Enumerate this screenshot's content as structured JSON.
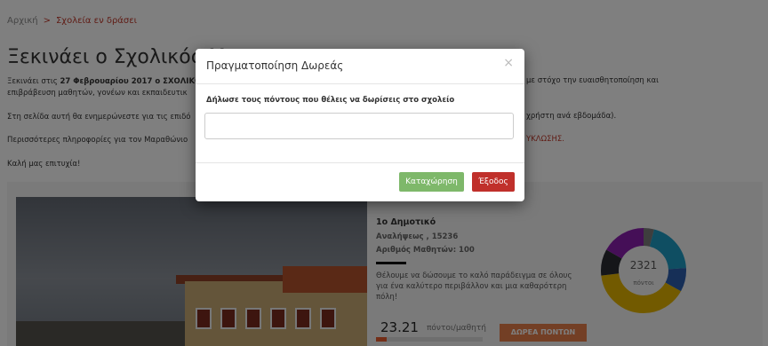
{
  "breadcrumb": {
    "home": "Αρχική",
    "separator": ">",
    "current": "Σχολεία εν δράσει"
  },
  "page": {
    "title": "Ξεκινάει ο Σχολικός Μ",
    "p1_prefix": "Ξεκινάει στις ",
    "p1_bold": "27 Φεβρουαρίου 2017 ο ΣΧΟΛΙΚΟ",
    "p1_right": "με στόχο την ευαισθητοποίηση και",
    "p1_line2": "επιβράβευση μαθητών, γονέων και εκπαιδευτικ",
    "p2_left": "Στη σελίδα αυτή θα ενημερώνεστε για τις επιδό",
    "p2_right": "χρήστη ανά εβδομάδα).",
    "p3_left": "Περισσότερες πληροφορίες για τον Μαραθώνιο",
    "p3_right": "ΥΚΛΩΣΗΣ.",
    "p4": "Καλή μας επιτυχία!"
  },
  "school": {
    "name": "1ο Δημοτικό",
    "address": "Αναλήψεως , 15236",
    "students": "Αριθμός Μαθητών: 100",
    "slogan": "Θέλουμε να δώσουμε το καλό παράδειγμα σε όλους για ένα καλύτερο περιβάλλον και μια καθαρότερη πόλη!",
    "points_per_student": "23.21",
    "points_unit": "πόντοι/μαθητή",
    "progress_fraction": 0.1,
    "donate_label": "ΔΩΡΕΑ ΠΟΝΤΩΝ"
  },
  "donut": {
    "total": "2321",
    "unit": "πόντοι",
    "segments": [
      {
        "value": 0.04,
        "color": "#7d7d7d"
      },
      {
        "value": 0.2,
        "color": "#1f9dc4"
      },
      {
        "value": 0.09,
        "color": "#2d5fae"
      },
      {
        "value": 0.4,
        "color": "#e5b400"
      },
      {
        "value": 0.1,
        "color": "#2a2d33"
      },
      {
        "value": 0.17,
        "color": "#8b1fae"
      }
    ]
  },
  "modal": {
    "title": "Πραγματοποίηση Δωρεάς",
    "close": "×",
    "label": "Δήλωσε τους πόντους που θέλεις να δωρίσεις στο σχολείο",
    "input_value": "",
    "save_label": "Καταχώρηση",
    "exit_label": "Έξοδος"
  }
}
